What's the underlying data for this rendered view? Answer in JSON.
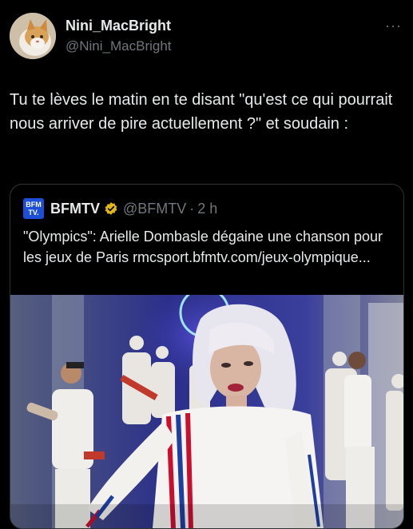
{
  "author": {
    "display_name": "Nini_MacBright",
    "handle": "@Nini_MacBright"
  },
  "more_icon": "more-horizontal-icon",
  "tweet": {
    "text": "Tu te lèves le matin en te disant \"qu'est ce qui pourrait nous arriver de pire actuellement ?\" et soudain :"
  },
  "quote": {
    "logo_top": "BFM",
    "logo_bottom": "TV.",
    "name": "BFMTV",
    "handle": "@BFMTV",
    "separator": "·",
    "time": "2 h",
    "text": "\"Olympics\": Arielle Dombasle dégaine une chanson pour les jeux de Paris rmcsport.bfmtv.com/jeux-olympique...",
    "verified_color": "#e2b719",
    "logo_color": "#1d4ed8"
  },
  "colors": {
    "background": "#000000",
    "text": "#e7e9ea",
    "muted": "#71767b",
    "border": "#2f3336"
  }
}
